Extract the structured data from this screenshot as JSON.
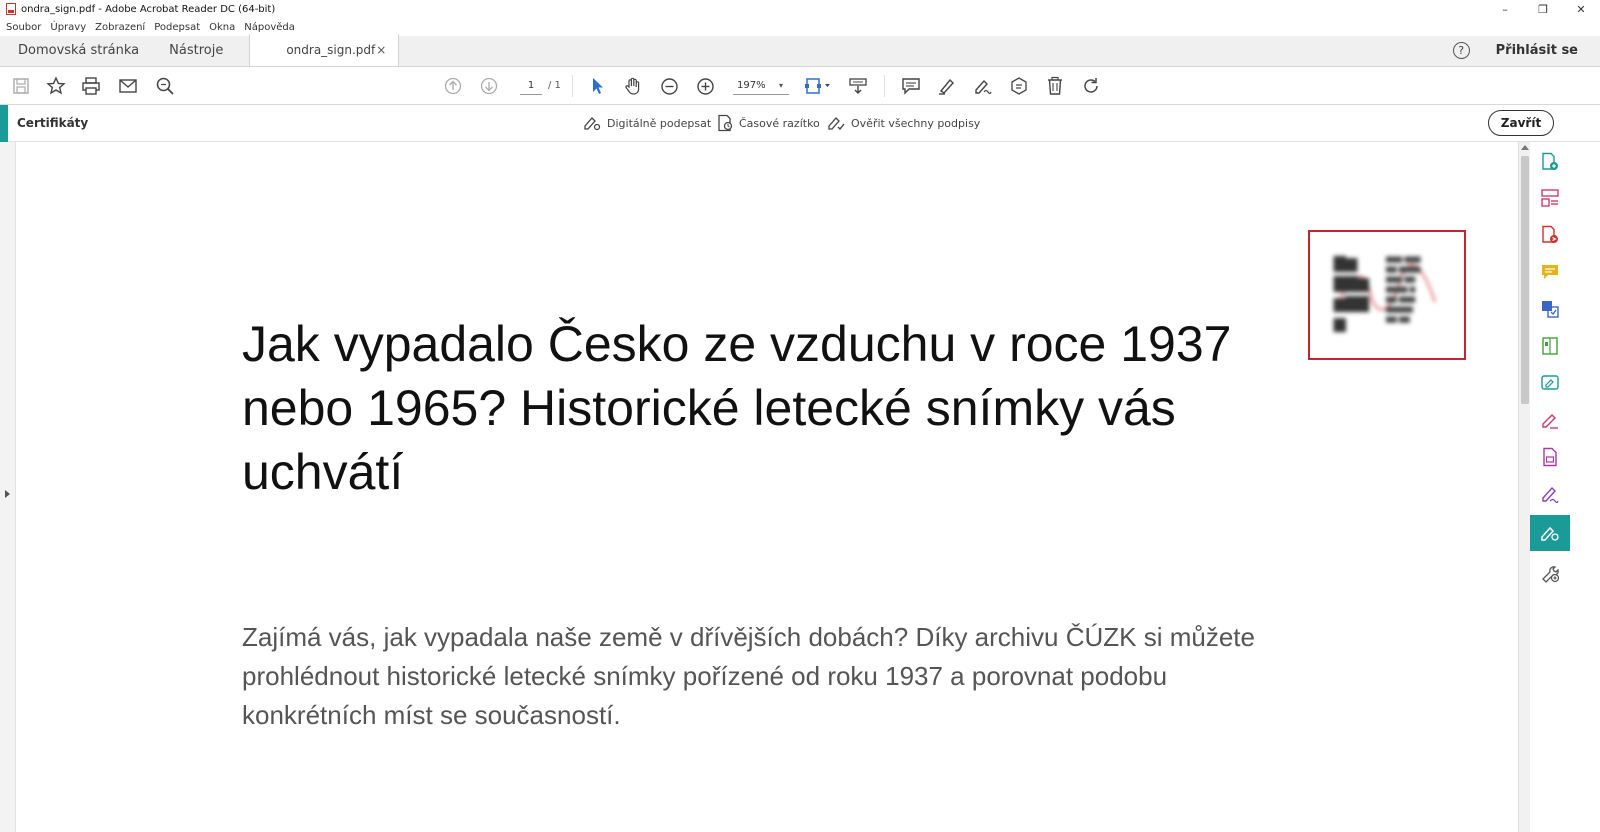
{
  "window": {
    "title": "ondra_sign.pdf - Adobe Acrobat Reader DC (64-bit)",
    "controls": [
      "–",
      "❐",
      "✕"
    ]
  },
  "menu": {
    "items": [
      "Soubor",
      "Úpravy",
      "Zobrazení",
      "Podepsat",
      "Okna",
      "Nápověda"
    ]
  },
  "tabs": {
    "home": "Domovská stránka",
    "tools": "Nástroje",
    "document": "ondra_sign.pdf",
    "close_glyph": "×",
    "help_glyph": "?",
    "signin": "Přihlásit se"
  },
  "toolbar": {
    "page_current": "1",
    "page_total": "/ 1",
    "zoom": "197%",
    "zoom_caret": "▾"
  },
  "certificates": {
    "title": "Certifikáty",
    "digital_sign": "Digitálně podepsat",
    "timestamp": "Časové razítko",
    "verify_all": "Ověřit všechny podpisy",
    "close": "Zavřít"
  },
  "document": {
    "headline": "Jak vypadalo Česko ze vzduchu v roce 1937 nebo 1965? Historické letecké snímky vás uchvátí",
    "lead": "Zajímá vás, jak vypadala naše země v dřívějších dobách? Díky archivu ČÚZK si můžete prohlédnout historické letecké snímky pořízené od roku 1937 a porovnat podobu konkrétních míst se současností."
  },
  "colors": {
    "accent": "#1a9b97",
    "signature_border": "#c8232c",
    "right_panel_icons": [
      "#1a9b97",
      "#d23a6a",
      "#d33131",
      "#e6b319",
      "#3b66c4",
      "#44a03c",
      "#1a9b97",
      "#d23a6a",
      "#a43aa8",
      "#8a3fb0",
      "#ffffff",
      "#555555"
    ]
  }
}
